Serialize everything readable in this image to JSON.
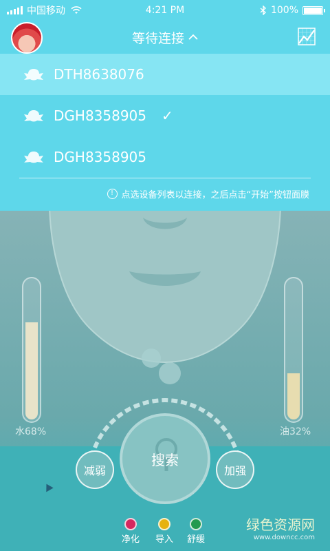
{
  "status_bar": {
    "carrier": "中国移动",
    "time": "4:21 PM",
    "battery_text": "100%",
    "battery_level": 1.0,
    "icons": [
      "signal-icon",
      "wifi-icon",
      "bluetooth-icon",
      "battery-icon"
    ]
  },
  "header": {
    "title": "等待连接",
    "chevron": "^",
    "avatar_icon": "avatar",
    "chart_icon": "chart-icon"
  },
  "devices": {
    "items": [
      {
        "label": "DTH8638076",
        "highlighted": true,
        "checked": false
      },
      {
        "label": "DGH8358905",
        "highlighted": false,
        "checked": true
      },
      {
        "label": "DGH8358905",
        "highlighted": false,
        "checked": false
      }
    ],
    "check_mark": "✓",
    "hint_icon": "!",
    "hint": "点选设备列表以连接，之后点击“开始”按钮面膜"
  },
  "levels": {
    "water": {
      "label": "水68%",
      "value": 0.68
    },
    "oil": {
      "label": "油32%",
      "value": 0.32
    }
  },
  "controls": {
    "minus_label": "减弱",
    "plus_label": "加强",
    "search_label": "搜索"
  },
  "modes": [
    {
      "label": "净化",
      "color": "#d6285f"
    },
    {
      "label": "导入",
      "color": "#e6b20e"
    },
    {
      "label": "舒缓",
      "color": "#229a4f"
    }
  ],
  "watermark": {
    "main": "绿色资源网",
    "sub": "www.downcc.com"
  }
}
